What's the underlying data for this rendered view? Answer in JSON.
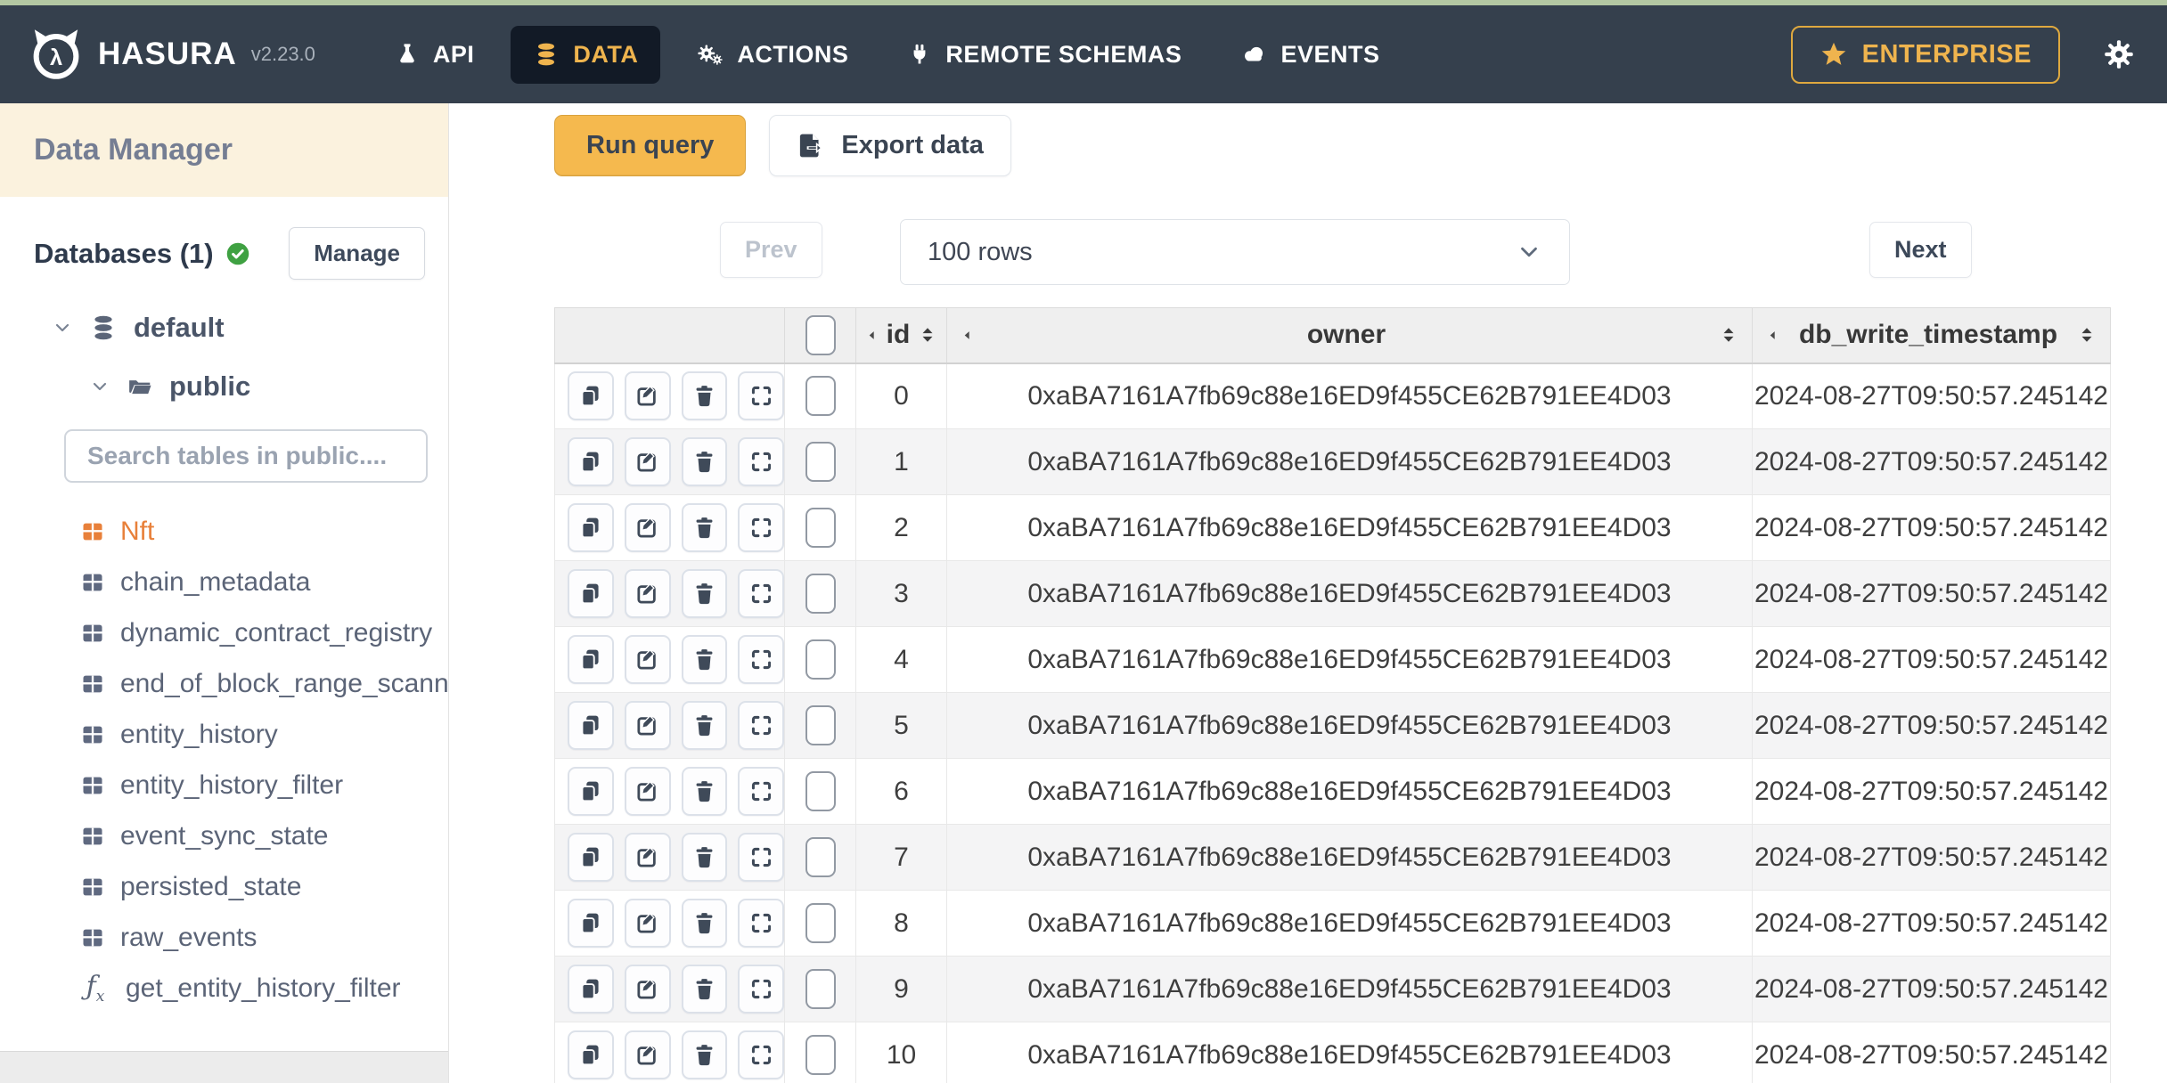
{
  "colors": {
    "top_strip": "#b3c7a2",
    "nav_bg": "#35404d",
    "active_tab_bg": "#121a26",
    "accent_gold": "#efb44e",
    "sidebar_cream": "#fbf2de",
    "nft_orange": "#e8803a",
    "check_green": "#3fa142",
    "run_query_bg": "#f5b94e"
  },
  "nav": {
    "brand": "HASURA",
    "version": "v2.23.0",
    "items": [
      {
        "label": "API",
        "active": false
      },
      {
        "label": "DATA",
        "active": true
      },
      {
        "label": "ACTIONS",
        "active": false
      },
      {
        "label": "REMOTE SCHEMAS",
        "active": false
      },
      {
        "label": "EVENTS",
        "active": false
      }
    ],
    "enterprise_label": "ENTERPRISE"
  },
  "sidebar": {
    "title": "Data Manager",
    "databases_label": "Databases (1)",
    "manage_label": "Manage",
    "database_name": "default",
    "schema_name": "public",
    "search_placeholder": "Search tables in public....",
    "tables": [
      {
        "label": "Nft",
        "active": true
      },
      {
        "label": "chain_metadata",
        "active": false
      },
      {
        "label": "dynamic_contract_registry",
        "active": false
      },
      {
        "label": "end_of_block_range_scanned_data",
        "active": false
      },
      {
        "label": "entity_history",
        "active": false
      },
      {
        "label": "entity_history_filter",
        "active": false
      },
      {
        "label": "event_sync_state",
        "active": false
      },
      {
        "label": "persisted_state",
        "active": false
      },
      {
        "label": "raw_events",
        "active": false
      }
    ],
    "function_name": "get_entity_history_filter"
  },
  "toolbar": {
    "run_query": "Run query",
    "export_data": "Export data"
  },
  "pagination": {
    "prev": "Prev",
    "rows_per_page": "100 rows",
    "next": "Next"
  },
  "grid": {
    "columns": [
      "id",
      "owner",
      "db_write_timestamp"
    ],
    "rows": [
      {
        "id": "0",
        "owner": "0xaBA7161A7fb69c88e16ED9f455CE62B791EE4D03",
        "db_write_timestamp": "2024-08-27T09:50:57.245142"
      },
      {
        "id": "1",
        "owner": "0xaBA7161A7fb69c88e16ED9f455CE62B791EE4D03",
        "db_write_timestamp": "2024-08-27T09:50:57.245142"
      },
      {
        "id": "2",
        "owner": "0xaBA7161A7fb69c88e16ED9f455CE62B791EE4D03",
        "db_write_timestamp": "2024-08-27T09:50:57.245142"
      },
      {
        "id": "3",
        "owner": "0xaBA7161A7fb69c88e16ED9f455CE62B791EE4D03",
        "db_write_timestamp": "2024-08-27T09:50:57.245142"
      },
      {
        "id": "4",
        "owner": "0xaBA7161A7fb69c88e16ED9f455CE62B791EE4D03",
        "db_write_timestamp": "2024-08-27T09:50:57.245142"
      },
      {
        "id": "5",
        "owner": "0xaBA7161A7fb69c88e16ED9f455CE62B791EE4D03",
        "db_write_timestamp": "2024-08-27T09:50:57.245142"
      },
      {
        "id": "6",
        "owner": "0xaBA7161A7fb69c88e16ED9f455CE62B791EE4D03",
        "db_write_timestamp": "2024-08-27T09:50:57.245142"
      },
      {
        "id": "7",
        "owner": "0xaBA7161A7fb69c88e16ED9f455CE62B791EE4D03",
        "db_write_timestamp": "2024-08-27T09:50:57.245142"
      },
      {
        "id": "8",
        "owner": "0xaBA7161A7fb69c88e16ED9f455CE62B791EE4D03",
        "db_write_timestamp": "2024-08-27T09:50:57.245142"
      },
      {
        "id": "9",
        "owner": "0xaBA7161A7fb69c88e16ED9f455CE62B791EE4D03",
        "db_write_timestamp": "2024-08-27T09:50:57.245142"
      },
      {
        "id": "10",
        "owner": "0xaBA7161A7fb69c88e16ED9f455CE62B791EE4D03",
        "db_write_timestamp": "2024-08-27T09:50:57.245142"
      }
    ]
  }
}
